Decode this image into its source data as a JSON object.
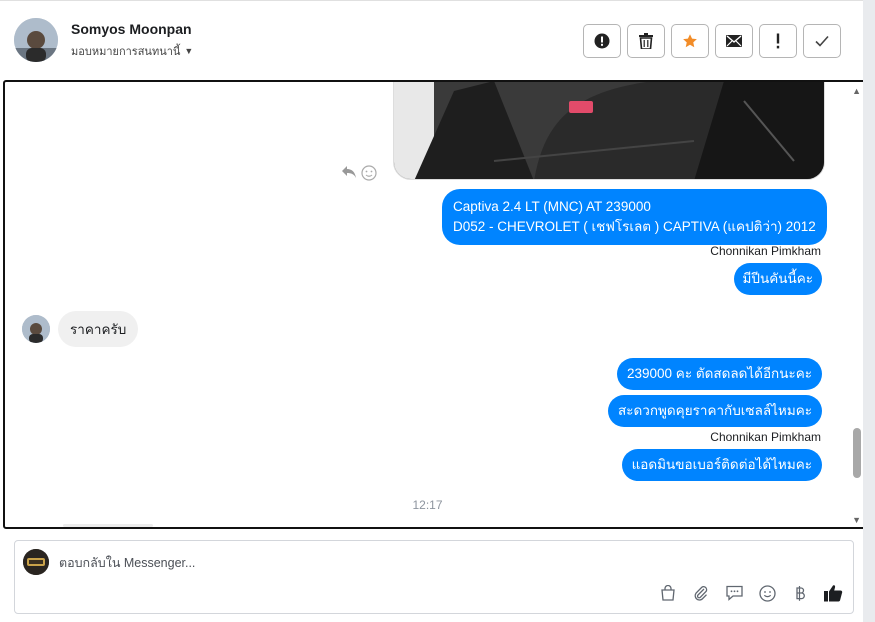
{
  "header": {
    "contact_name": "Somyos Moonpan",
    "assign_label": "มอบหมายการสนทนานี้",
    "toolbar": [
      {
        "name": "report-spam",
        "icon": "alert-circle-icon"
      },
      {
        "name": "delete",
        "icon": "trash-icon"
      },
      {
        "name": "star",
        "icon": "star-icon"
      },
      {
        "name": "mark-unread",
        "icon": "envelope-icon"
      },
      {
        "name": "follow-up",
        "icon": "exclamation-icon"
      },
      {
        "name": "mark-done",
        "icon": "checkmark-icon"
      }
    ],
    "star_color": "#f28c28"
  },
  "messages": {
    "out1_line1": "Captiva 2.4 LT (MNC) AT 239000",
    "out1_line2": "D052 - CHEVROLET ( เชฟโรเลต ) CAPTIVA (แคปติว่า) 2012",
    "sender1": "Chonnikan Pimkham",
    "out2": "มีปีนคันนี้คะ",
    "in1": "ราคาครับ",
    "out3": "239000 คะ ตัดสดลดได้อีกนะคะ",
    "out4": "สะดวกพูดคุยราคากับเซลล์ไหมคะ",
    "sender2": "Chonnikan Pimkham",
    "out5": "แอดมินขอเบอร์ติดต่อได้ไหมคะ",
    "timestamp": "12:17"
  },
  "reply": {
    "placeholder": "ตอบกลับใน Messenger..."
  },
  "colors": {
    "outgoing_bubble": "#0084ff",
    "incoming_bubble": "#f0f0f0"
  }
}
